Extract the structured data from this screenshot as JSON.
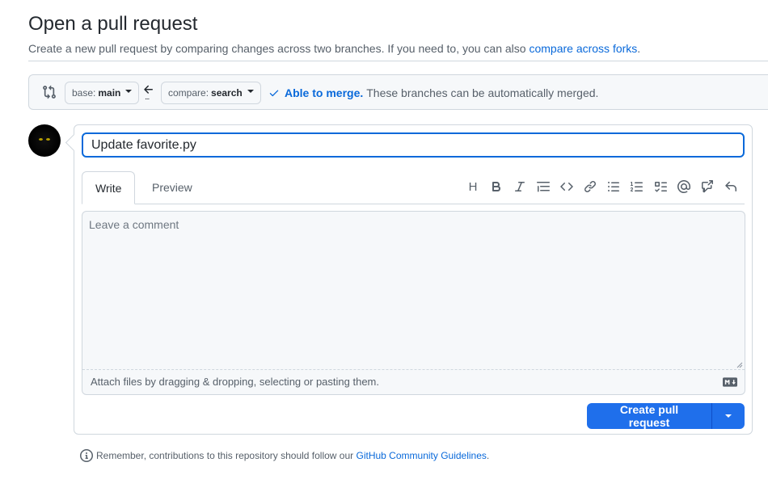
{
  "header": {
    "title": "Open a pull request",
    "subtitle": "Create a new pull request by comparing changes across two branches. If you need to, you can also",
    "subtitle_link": "compare across forks",
    "subtitle_end": "."
  },
  "range": {
    "base_prefix": "base:",
    "base_branch": "main",
    "compare_prefix": "compare:",
    "compare_branch": "search",
    "dots": "...",
    "merge_ok": "Able to merge.",
    "merge_text": "These branches can be automatically merged."
  },
  "form": {
    "title_value": "Update favorite.py",
    "tabs": [
      {
        "label": "Write",
        "active": true
      },
      {
        "label": "Preview",
        "active": false
      }
    ],
    "toolbar": {
      "heading": "H"
    },
    "comment_placeholder": "Leave a comment",
    "attach_text": "Attach files by dragging & dropping, selecting or pasting them.",
    "submit_label": "Create pull request"
  },
  "footer": {
    "text": "Remember, contributions to this repository should follow our",
    "link": "GitHub Community Guidelines",
    "end": "."
  },
  "colors": {
    "accent": "#0969da",
    "button": "#1f6feb",
    "border": "#d0d7de"
  }
}
